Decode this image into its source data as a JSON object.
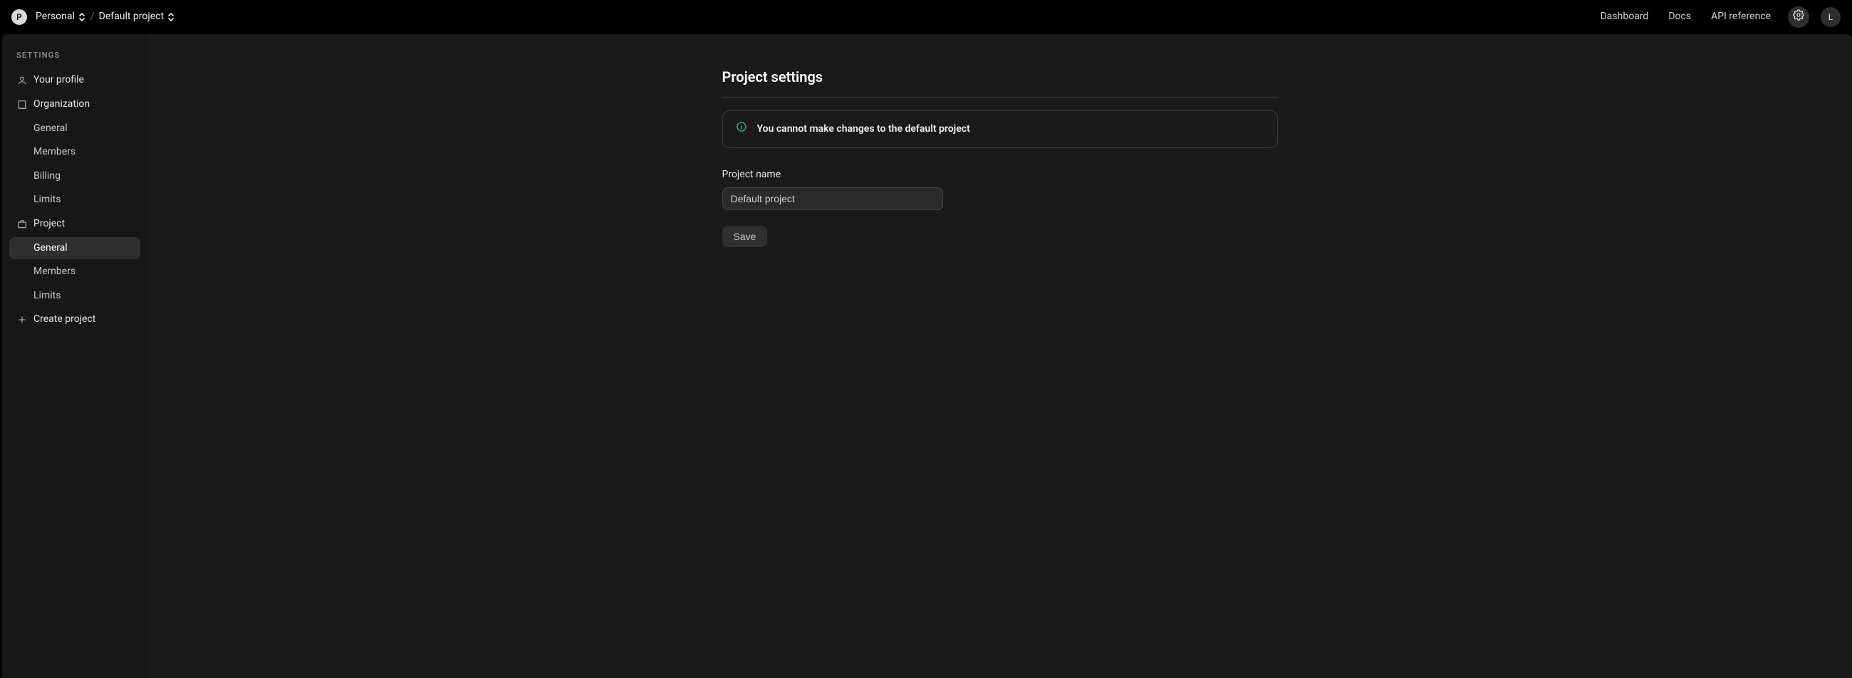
{
  "header": {
    "org_avatar_letter": "P",
    "org_name": "Personal",
    "project_name": "Default project",
    "nav": {
      "dashboard": "Dashboard",
      "docs": "Docs",
      "api_ref": "API reference"
    },
    "user_avatar_letter": "L"
  },
  "sidebar": {
    "heading": "SETTINGS",
    "profile": "Your profile",
    "organization": "Organization",
    "org_children": {
      "general": "General",
      "members": "Members",
      "billing": "Billing",
      "limits": "Limits"
    },
    "project": "Project",
    "project_children": {
      "general": "General",
      "members": "Members",
      "limits": "Limits"
    },
    "create_project": "Create project"
  },
  "main": {
    "title": "Project settings",
    "notice": "You cannot make changes to the default project",
    "name_label": "Project name",
    "name_value": "Default project",
    "save_label": "Save"
  }
}
